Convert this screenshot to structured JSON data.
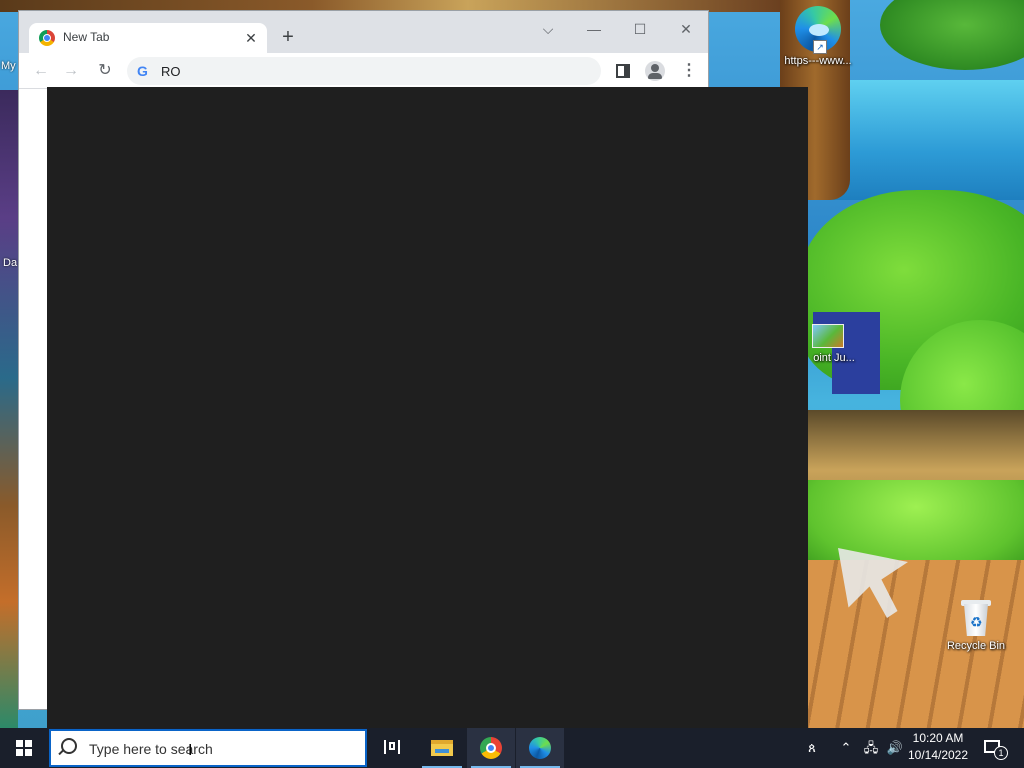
{
  "desktop": {
    "icons": [
      {
        "label": "https---www..."
      },
      {
        "label": "oint Ju..."
      },
      {
        "label": "Recycle Bin"
      }
    ],
    "left_labels": [
      "My",
      "Da"
    ]
  },
  "browser": {
    "tab": {
      "title": "New Tab",
      "close_glyph": "✕"
    },
    "new_tab_glyph": "+",
    "window_controls": {
      "tab_search": "⌵",
      "minimize": "—",
      "maximize": "☐",
      "close": "✕"
    },
    "nav": {
      "back": "←",
      "forward": "→",
      "reload": "↻"
    },
    "omnibox": {
      "engine_icon": "G",
      "value": "RO"
    },
    "menu_glyph": "⋮"
  },
  "taskbar": {
    "search_placeholder": "Type here to search",
    "clock": {
      "time": "10:20 AM",
      "date": "10/14/2022"
    },
    "notification_count": "1",
    "tray": {
      "people": "ጰ",
      "chevron": "⌃",
      "network": "🖧",
      "volume": "🔊"
    }
  },
  "icons": [
    "chrome-icon",
    "edge-icon",
    "file-explorer-icon",
    "task-view-icon",
    "windows-icon",
    "search-icon",
    "recycle-bin-icon"
  ]
}
